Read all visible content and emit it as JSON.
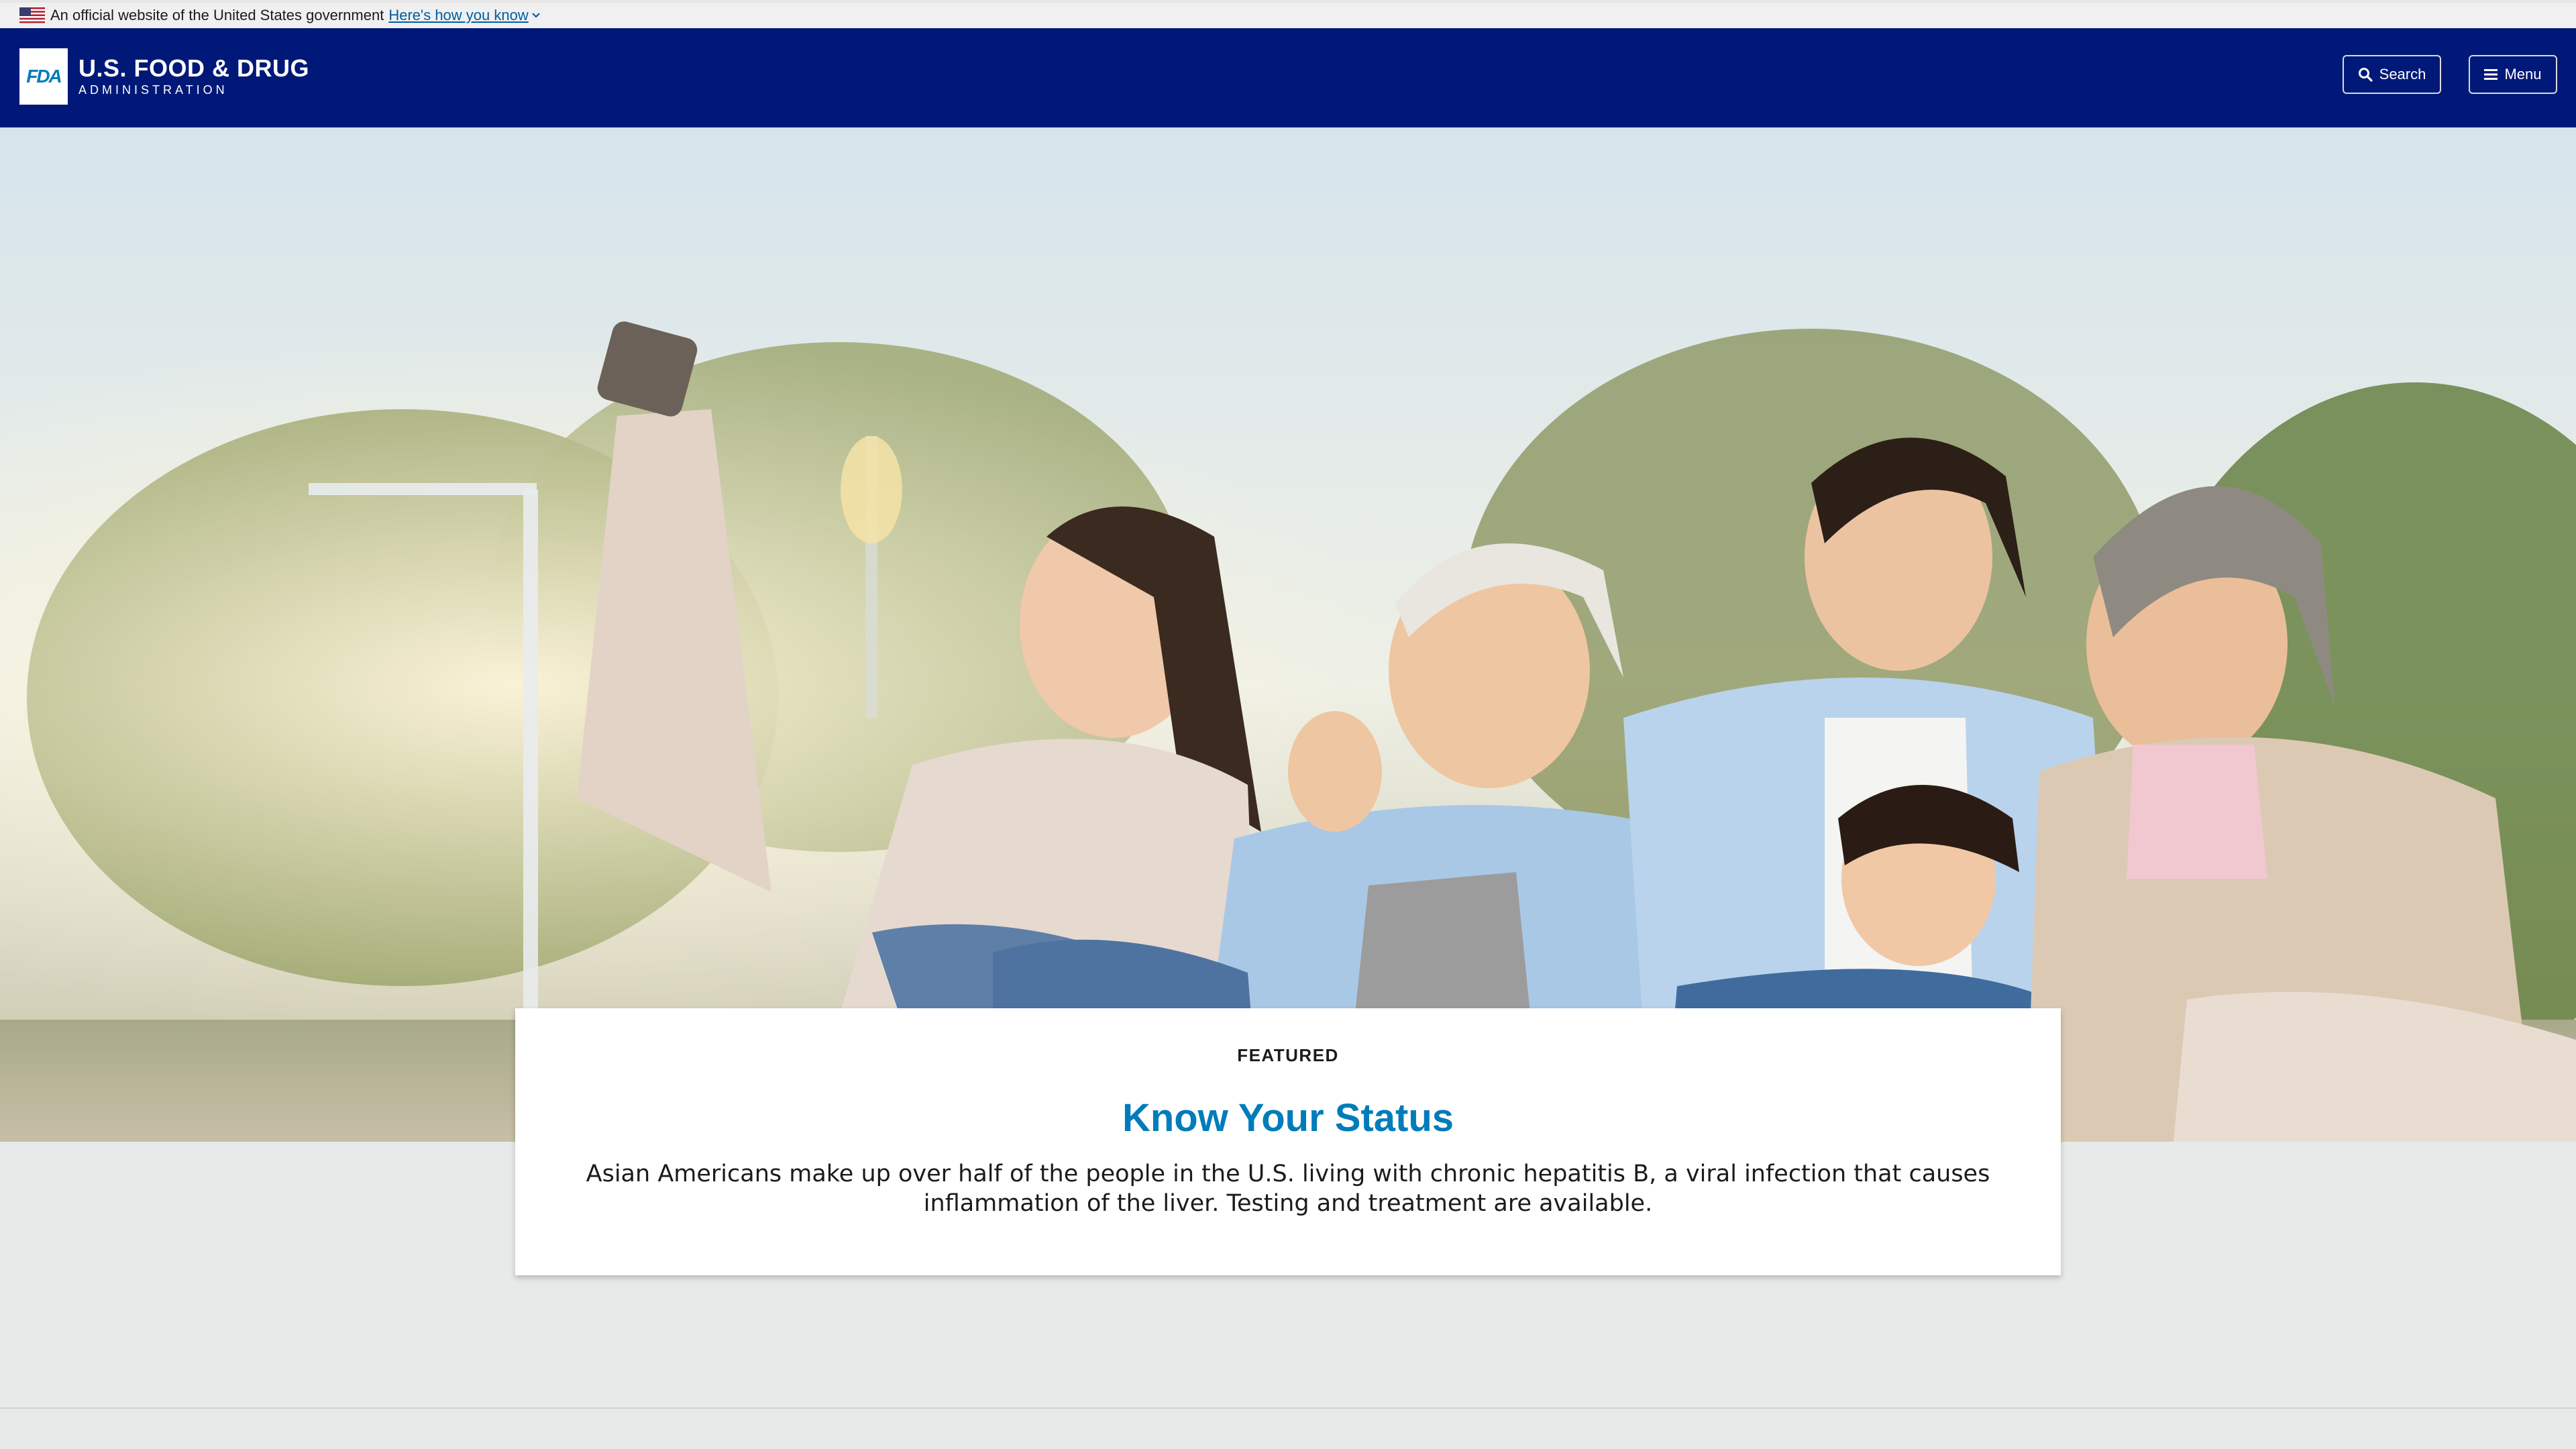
{
  "gov_banner": {
    "text": "An official website of the United States government",
    "link_label": "Here's how you know",
    "flag_icon": "us-flag-icon",
    "chevron_icon": "chevron-down-icon"
  },
  "header": {
    "logo_badge": "FDA",
    "logo_title": "U.S. FOOD & DRUG",
    "logo_subtitle": "ADMINISTRATION",
    "search_label": "Search",
    "menu_label": "Menu",
    "search_icon": "search-icon",
    "menu_icon": "hamburger-menu-icon",
    "colors": {
      "header_bg": "#001978",
      "accent": "#007cba",
      "link": "#005ea2"
    }
  },
  "hero": {
    "image_icon": "hero-family-selfie-photo"
  },
  "featured": {
    "eyebrow": "FEATURED",
    "title": "Know Your Status",
    "description": "Asian Americans make up over half of the people in the U.S. living with chronic hepatitis B, a viral infection that causes inflammation of the liver. Testing and treatment are available."
  }
}
